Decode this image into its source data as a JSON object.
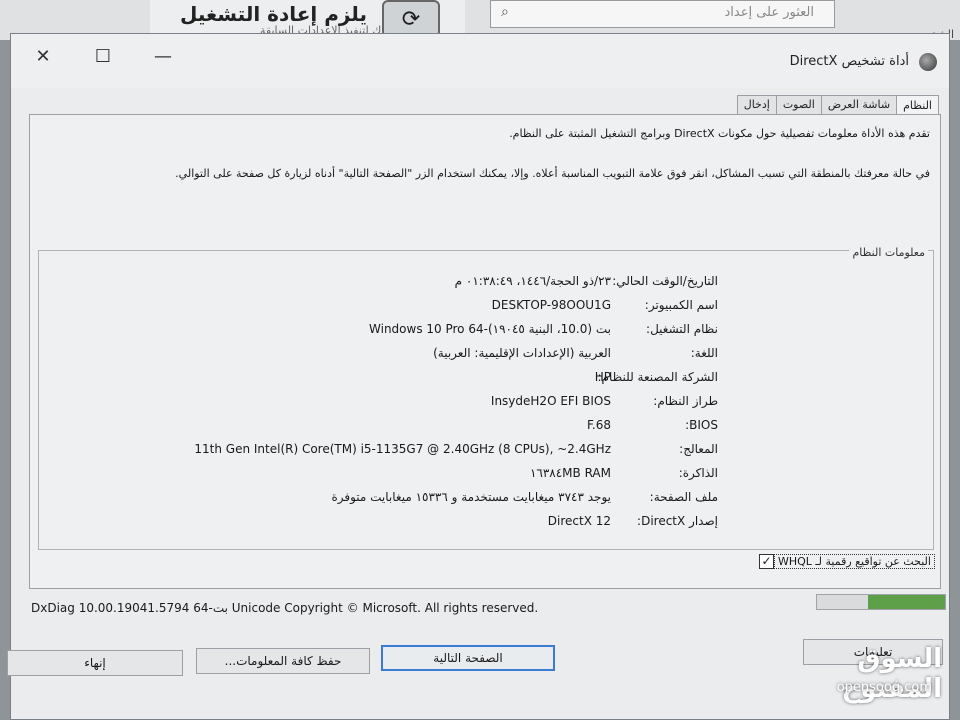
{
  "background": {
    "window_title": "يلزم إعادة التشغيل",
    "window_subtitle": "ات لجهازك لتنفيذ الإعدادات السابقة",
    "search_placeholder": "العثور على إعداد",
    "right_label": "الشخصي"
  },
  "dialog": {
    "title": "أداة تشخيص DirectX",
    "tabs": [
      "النظام",
      "شاشة العرض",
      "الصوت",
      "إدخال"
    ],
    "active_tab": 0,
    "intro_line1": "تقدم هذه الأداة معلومات تفصيلية حول مكونات DirectX وبرامج التشغيل المثبتة على النظام.",
    "intro_line2": "في حالة معرفتك بالمنطقة التي تسبب المشاكل، انقر فوق علامة التبويب المناسبة أعلاه. وإلا، يمكنك استخدام الزر \"الصفحة التالية\" أدناه لزيارة كل صفحة على التوالي.",
    "system_info_label": "معلومات النظام",
    "system_info": [
      {
        "label": "التاريخ/الوقت الحالي:",
        "value": "٢٣/ذو الحجة/١٤٤٦، ٠١:٣٨:٤٩ م"
      },
      {
        "label": "اسم الكمبيوتر:",
        "value": "DESKTOP-98OOU1G"
      },
      {
        "label": "نظام التشغيل:",
        "value": "Windows 10 Pro 64-بت (10.0، البنية ١٩٠٤٥)"
      },
      {
        "label": "اللغة:",
        "value": "العربية (الإعدادات الإقليمية: العربية)"
      },
      {
        "label": "الشركة المصنعة للنظام:",
        "value": "HP"
      },
      {
        "label": "طراز النظام:",
        "value": "InsydeH2O EFI BIOS"
      },
      {
        "label": "BIOS:",
        "value": "F.68"
      },
      {
        "label": "المعالج:",
        "value": "11th Gen Intel(R) Core(TM) i5-1135G7 @ 2.40GHz (8 CPUs), ~2.4GHz"
      },
      {
        "label": "الذاكرة:",
        "value": "١٦٣٨٤MB RAM"
      },
      {
        "label": "ملف الصفحة:",
        "value": "يوجد ٣٧٤٣ ميغابايت مستخدمة و ١٥٣٣٦ ميغابايت متوفرة"
      },
      {
        "label": "إصدار DirectX:",
        "value": "DirectX 12"
      }
    ],
    "whql_label": "البحث عن تواقيع رقمية لـ WHQL",
    "whql_checked": true,
    "copyright": "DxDiag 10.00.19041.5794 64-بت Unicode  Copyright © Microsoft. All rights reserved.",
    "progress_percent": 60,
    "buttons": {
      "help": "تعليمات",
      "next": "الصفحة التالية",
      "save": "حفظ كافة المعلومات...",
      "exit": "إنهاء"
    }
  },
  "watermark": {
    "arabic": "السوق المفتوح",
    "english": "opensooq.com"
  },
  "colors": {
    "progress": "#5ea04a",
    "focus": "#3a7bd5"
  }
}
